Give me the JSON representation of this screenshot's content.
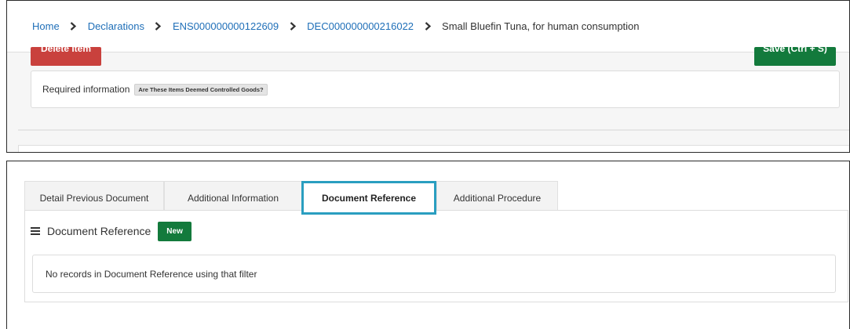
{
  "breadcrumb": {
    "items": [
      {
        "label": "Home",
        "type": "link"
      },
      {
        "label": "Declarations",
        "type": "link"
      },
      {
        "label": "ENS000000000122609",
        "type": "link"
      },
      {
        "label": "DEC000000000216022",
        "type": "link"
      },
      {
        "label": "Small Bluefin Tuna, for human consumption",
        "type": "current"
      }
    ]
  },
  "actions": {
    "delete_label": "Delete Item",
    "save_label": "Save (Ctrl + S)"
  },
  "required_info": {
    "label": "Required information",
    "tag": "Are These Items Deemed Controlled Goods?"
  },
  "tabs": [
    {
      "label": "Detail Previous Document",
      "active": false
    },
    {
      "label": "Additional Information",
      "active": false
    },
    {
      "label": "Document Reference",
      "active": true
    },
    {
      "label": "Additional Procedure",
      "active": false
    }
  ],
  "document_reference": {
    "title": "Document Reference",
    "new_label": "New",
    "empty_message": "No records in Document Reference using that filter"
  },
  "colors": {
    "link": "#1f6fb8",
    "danger": "#c9413d",
    "success": "#137a3c",
    "active_tab_highlight": "#2a9ec0"
  },
  "icons": {
    "breadcrumb_separator": "chevron-right-icon",
    "list_menu": "hamburger-menu-icon"
  }
}
